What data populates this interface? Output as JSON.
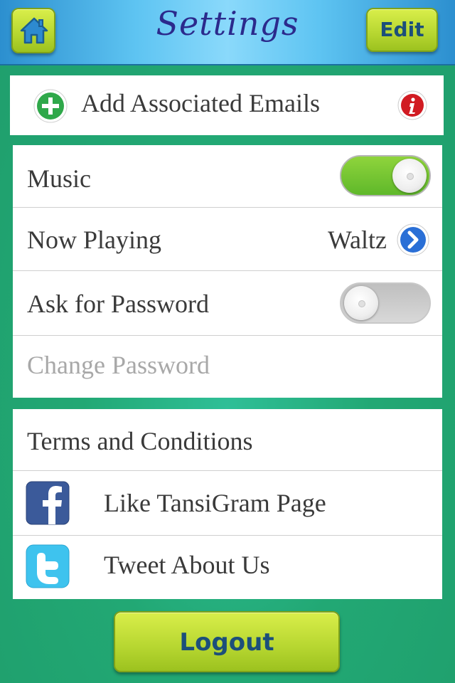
{
  "header": {
    "title": "Settings",
    "edit_label": "Edit",
    "home_icon": "home-icon"
  },
  "emails": {
    "label": "Add Associated Emails",
    "add_icon": "plus-icon",
    "info_icon": "info-icon"
  },
  "settings": {
    "music_label": "Music",
    "music_on": true,
    "now_playing_label": "Now Playing",
    "now_playing_value": "Waltz",
    "ask_password_label": "Ask for Password",
    "ask_password_on": false,
    "change_password_label": "Change Password"
  },
  "social": {
    "terms_label": "Terms and Conditions",
    "facebook_label": "Like TansiGram Page",
    "twitter_label": "Tweet About Us"
  },
  "footer": {
    "logout_label": "Logout"
  },
  "colors": {
    "accent_green": "#b6d630",
    "header_blue": "#5ec4f2",
    "background": "#22a874"
  }
}
